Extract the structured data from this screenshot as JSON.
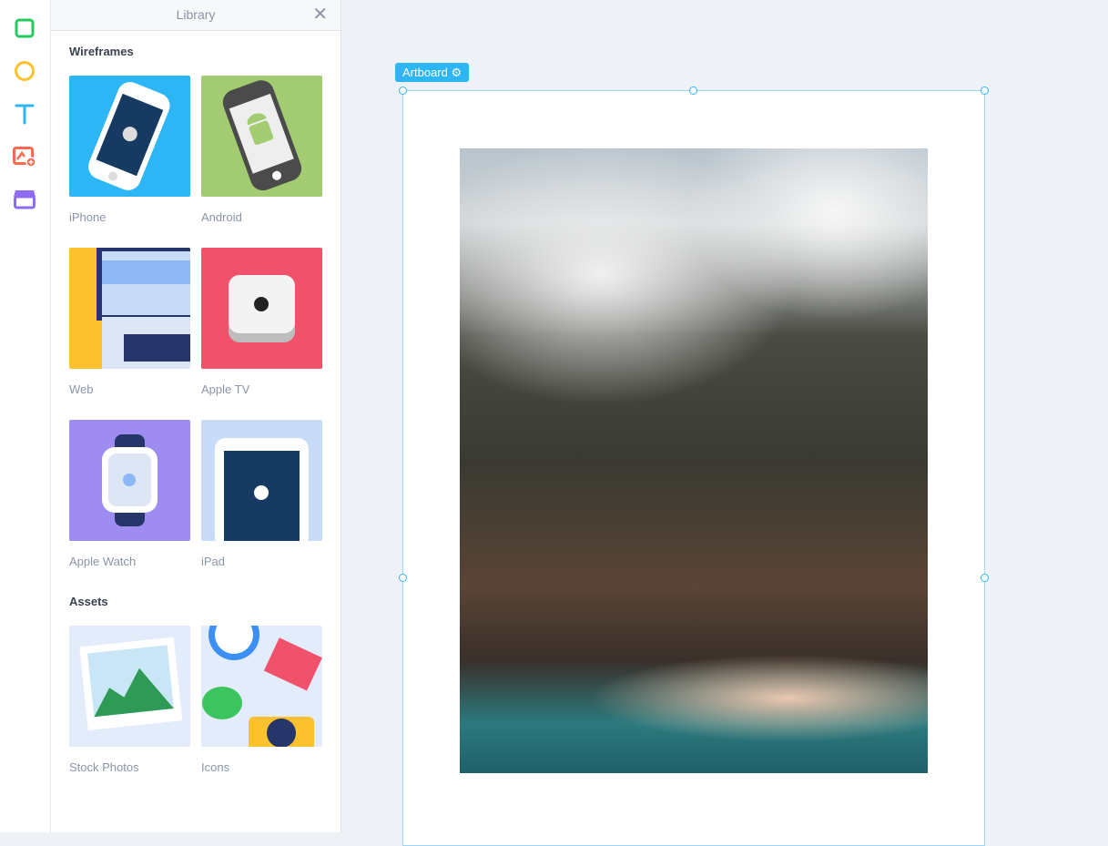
{
  "toolbar": {
    "tools": [
      {
        "name": "rectangle-tool",
        "icon": "square-icon",
        "color": "#26c95e"
      },
      {
        "name": "ellipse-tool",
        "icon": "circle-icon",
        "color": "#fcc12e"
      },
      {
        "name": "text-tool",
        "icon": "text-icon",
        "color": "#2db6f5"
      },
      {
        "name": "image-tool",
        "icon": "image-add-icon",
        "color": "#f86b4f"
      },
      {
        "name": "library-tool",
        "icon": "store-icon",
        "color": "#8d6cf2"
      }
    ]
  },
  "library": {
    "title": "Library",
    "close_icon": "close-icon",
    "wireframes_heading": "Wireframes",
    "wireframes": [
      {
        "label": "iPhone",
        "color": "#2db6f5"
      },
      {
        "label": "Android",
        "color": "#a3cb72"
      },
      {
        "label": "Web",
        "color": "#fcc12e"
      },
      {
        "label": "Apple TV",
        "color": "#f0526b"
      },
      {
        "label": "Apple Watch",
        "color": "#9f8cf0"
      },
      {
        "label": "iPad",
        "color": "#c8dcf8"
      }
    ],
    "assets_heading": "Assets",
    "assets": [
      {
        "label": "Stock Photos",
        "color": "#e3ecfb"
      },
      {
        "label": "Icons",
        "color": "#e3ecfb"
      }
    ]
  },
  "canvas": {
    "artboard_label": "Artboard",
    "artboard_icon": "gear-icon",
    "accent": "#2db6f5"
  }
}
